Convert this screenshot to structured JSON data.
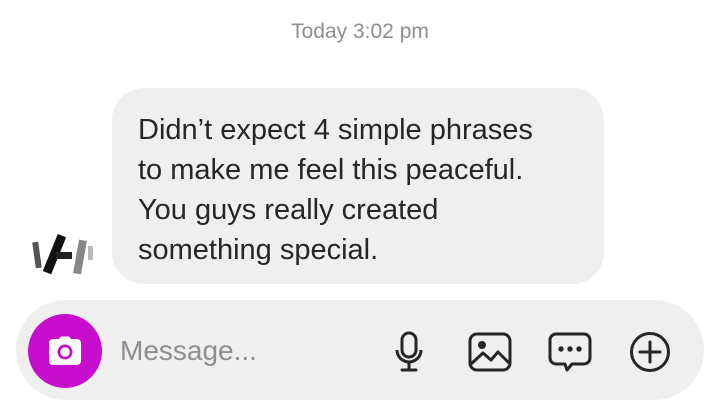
{
  "chat": {
    "timestamp": "Today 3:02 pm",
    "message_text": "Didn’t expect 4 simple phrases\nto make me feel this peaceful.\nYou guys really created\nsomething special."
  },
  "composer": {
    "placeholder": "Message...",
    "camera_icon": "camera-icon",
    "tools": [
      "microphone-icon",
      "image-icon",
      "chat-options-icon",
      "add-circle-icon"
    ]
  },
  "colors": {
    "accent": "#c70ecf",
    "bubble": "#efefef",
    "text": "#262626",
    "muted": "#8e8e8e"
  }
}
